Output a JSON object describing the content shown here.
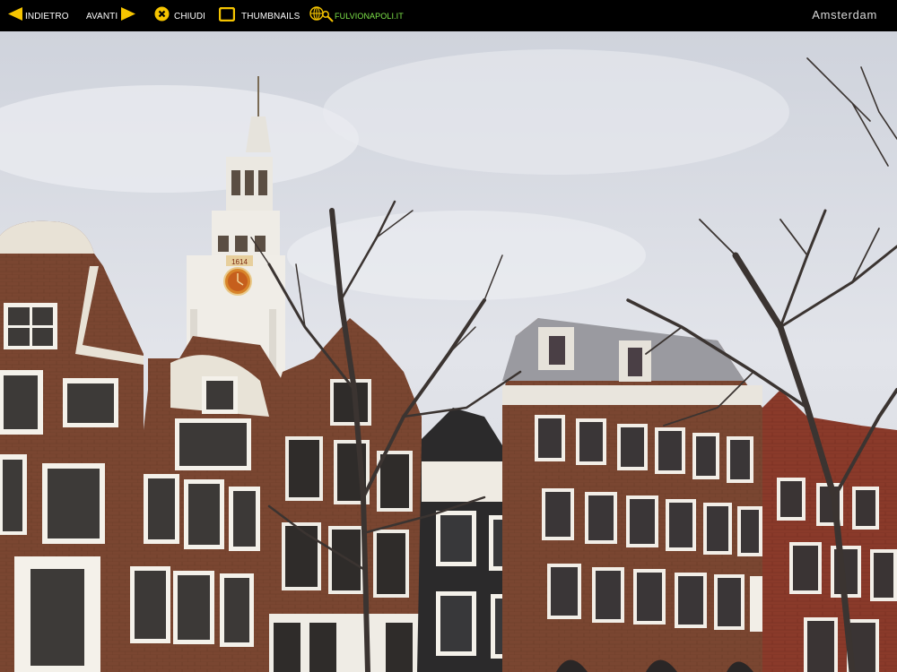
{
  "toolbar": {
    "back_label": "INDIETRO",
    "next_label": "AVANTI",
    "close_label": "CHIUDI",
    "thumbnails_label": "THUMBNAILS",
    "site_label": "FULVIONAPOLI.IT",
    "gallery_title": "Amsterdam"
  },
  "photo": {
    "clock_year": "1614"
  },
  "colors": {
    "toolbar_bg": "#000000",
    "icon_yellow": "#f5c400",
    "site_green": "#7fe64a",
    "sky": "#dcdfe6",
    "brick": "#7a4631"
  },
  "icons": [
    "arrow-left-icon",
    "arrow-right-icon",
    "close-icon",
    "thumbnails-icon",
    "globe-search-icon"
  ]
}
